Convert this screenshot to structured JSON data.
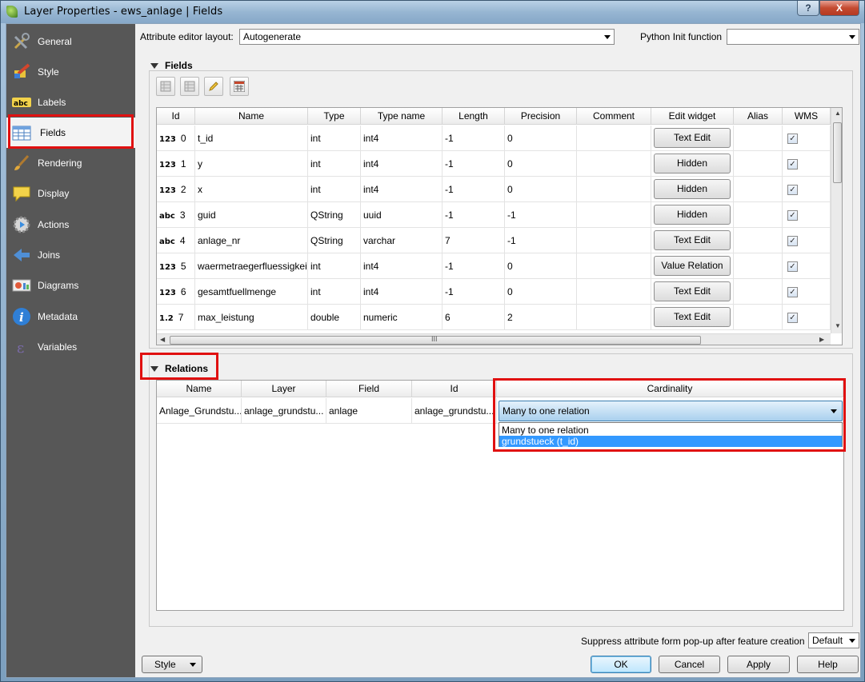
{
  "window": {
    "title": "Layer Properties - ews_anlage | Fields",
    "help_label": "?",
    "close_label": "X"
  },
  "sidebar": {
    "items": [
      {
        "label": "General",
        "icon": "tools-icon"
      },
      {
        "label": "Style",
        "icon": "style-brush-icon"
      },
      {
        "label": "Labels",
        "icon": "labels-abc-icon"
      },
      {
        "label": "Fields",
        "icon": "table-icon"
      },
      {
        "label": "Rendering",
        "icon": "paintbrush-icon"
      },
      {
        "label": "Display",
        "icon": "speech-bubble-icon"
      },
      {
        "label": "Actions",
        "icon": "gear-play-icon"
      },
      {
        "label": "Joins",
        "icon": "join-arrow-icon"
      },
      {
        "label": "Diagrams",
        "icon": "diagram-icon"
      },
      {
        "label": "Metadata",
        "icon": "info-icon"
      },
      {
        "label": "Variables",
        "icon": "epsilon-icon"
      }
    ],
    "selected": "Fields"
  },
  "top": {
    "layout_label": "Attribute editor layout:",
    "layout_value": "Autogenerate",
    "python_label": "Python Init function",
    "python_value": ""
  },
  "fields": {
    "section_title": "Fields",
    "toolbar": [
      "new-field-icon",
      "delete-field-icon",
      "edit-pencil-icon",
      "field-calculator-icon"
    ],
    "columns": [
      "Id",
      "Name",
      "Type",
      "Type name",
      "Length",
      "Precision",
      "Comment",
      "Edit widget",
      "Alias",
      "WMS"
    ],
    "rows": [
      {
        "tag": "123",
        "id": "0",
        "name": "t_id",
        "type": "int",
        "type_name": "int4",
        "length": "-1",
        "precision": "0",
        "comment": "",
        "widget": "Text Edit",
        "alias": "",
        "wms": true
      },
      {
        "tag": "123",
        "id": "1",
        "name": "y",
        "type": "int",
        "type_name": "int4",
        "length": "-1",
        "precision": "0",
        "comment": "",
        "widget": "Hidden",
        "alias": "",
        "wms": true
      },
      {
        "tag": "123",
        "id": "2",
        "name": "x",
        "type": "int",
        "type_name": "int4",
        "length": "-1",
        "precision": "0",
        "comment": "",
        "widget": "Hidden",
        "alias": "",
        "wms": true
      },
      {
        "tag": "abc",
        "id": "3",
        "name": "guid",
        "type": "QString",
        "type_name": "uuid",
        "length": "-1",
        "precision": "-1",
        "comment": "",
        "widget": "Hidden",
        "alias": "",
        "wms": true
      },
      {
        "tag": "abc",
        "id": "4",
        "name": "anlage_nr",
        "type": "QString",
        "type_name": "varchar",
        "length": "7",
        "precision": "-1",
        "comment": "",
        "widget": "Text Edit",
        "alias": "",
        "wms": true
      },
      {
        "tag": "123",
        "id": "5",
        "name": "waermetraegerfluessigkeit",
        "type": "int",
        "type_name": "int4",
        "length": "-1",
        "precision": "0",
        "comment": "",
        "widget": "Value Relation",
        "alias": "",
        "wms": true
      },
      {
        "tag": "123",
        "id": "6",
        "name": "gesamtfuellmenge",
        "type": "int",
        "type_name": "int4",
        "length": "-1",
        "precision": "0",
        "comment": "",
        "widget": "Text Edit",
        "alias": "",
        "wms": true
      },
      {
        "tag": "1.2",
        "id": "7",
        "name": "max_leistung",
        "type": "double",
        "type_name": "numeric",
        "length": "6",
        "precision": "2",
        "comment": "",
        "widget": "Text Edit",
        "alias": "",
        "wms": true
      }
    ],
    "hscroll_marker": "III"
  },
  "relations": {
    "section_title": "Relations",
    "columns": [
      "Name",
      "Layer",
      "Field",
      "Id",
      "Cardinality"
    ],
    "row": {
      "name": "Anlage_Grundstu...",
      "layer": "anlage_grundstu...",
      "field": "anlage",
      "id": "anlage_grundstu...",
      "cardinality": "Many to one relation"
    },
    "dropdown_options": [
      "Many to one relation",
      "grundstueck (t_id)"
    ],
    "dropdown_selected_index": 1
  },
  "bottom": {
    "suppress_label": "Suppress attribute form pop-up after feature creation",
    "suppress_value": "Default",
    "style_label": "Style",
    "ok_label": "OK",
    "cancel_label": "Cancel",
    "apply_label": "Apply",
    "help_label": "Help"
  },
  "colors": {
    "highlight_red": "#e01010",
    "selection_blue": "#3399ff",
    "sidebar_bg": "#575757"
  }
}
